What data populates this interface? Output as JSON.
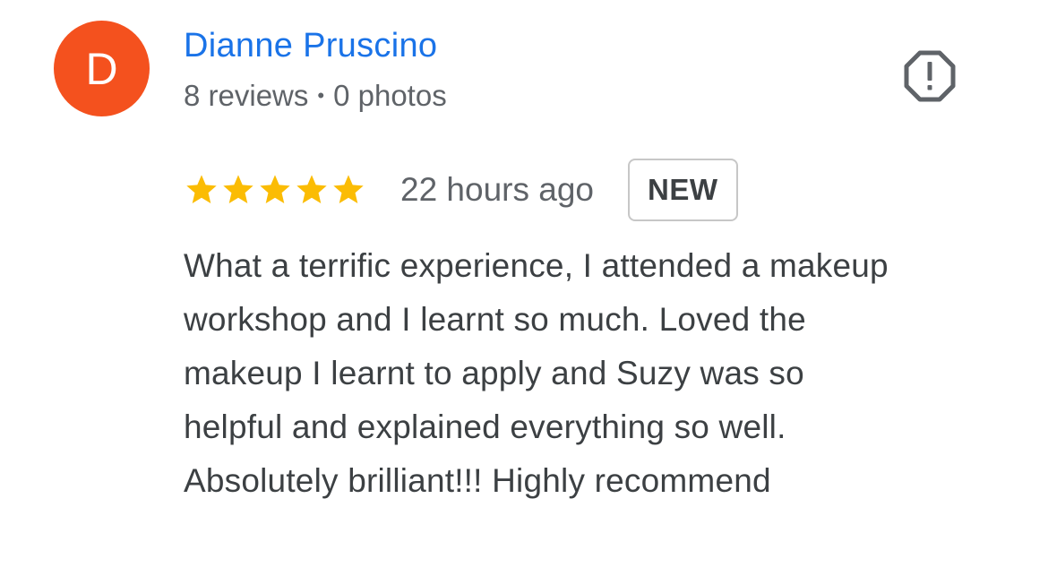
{
  "author": {
    "initial": "D",
    "name": "Dianne Pruscino",
    "reviews": "8 reviews",
    "separator": "•",
    "photos": "0 photos",
    "avatar_color": "#f4511e",
    "name_color": "#1a73e8"
  },
  "review": {
    "rating": 5,
    "max_rating": 5,
    "star_color": "#fbbc04",
    "time": "22 hours ago",
    "badge": "NEW",
    "text_lines": [
      "What a terrific experience, I attended a makeup",
      "workshop and I learnt so much. Loved the",
      "makeup I learnt to apply and Suzy was so",
      "helpful and explained everything so well.",
      "Absolutely brilliant!!! Highly recommend"
    ]
  },
  "icons": {
    "flag": "report-flag-icon",
    "star": "star-icon"
  }
}
